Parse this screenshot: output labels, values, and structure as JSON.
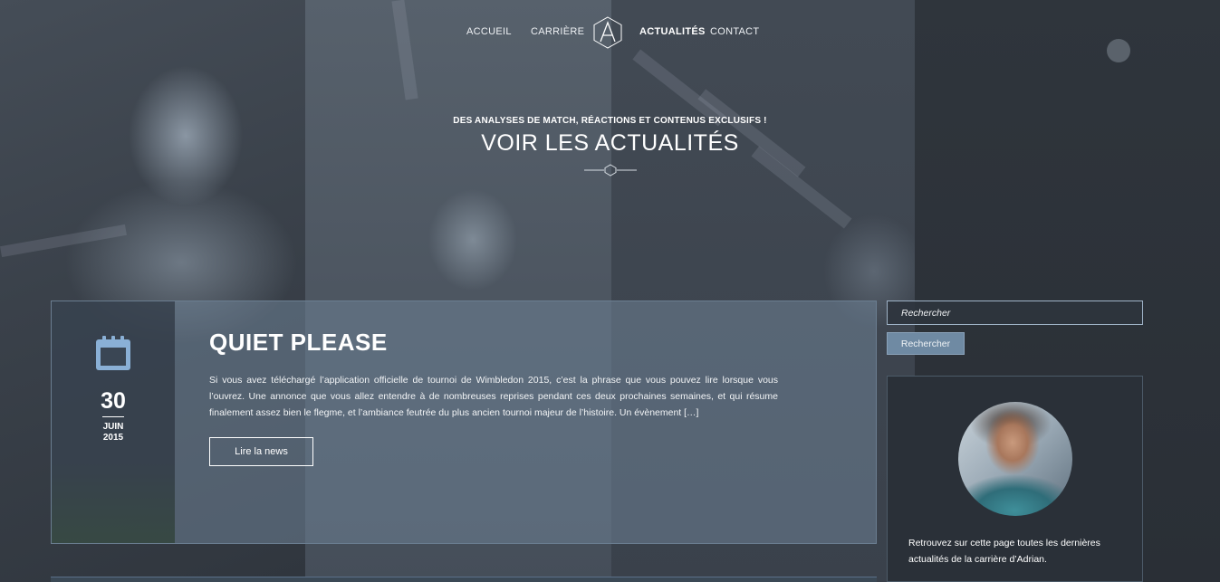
{
  "nav": {
    "items": [
      {
        "label": "ACCUEIL"
      },
      {
        "label": "CARRIÈRE"
      },
      {
        "label": "ACTUALITÉS",
        "active": true
      },
      {
        "label": "CONTACT"
      }
    ],
    "logo_icon": "a-monogram-hexagon-logo"
  },
  "hero": {
    "subtitle": "DES ANALYSES DE MATCH, RÉACTIONS ET CONTENUS EXCLUSIFS !",
    "title": "VOIR LES ACTUALITÉS"
  },
  "article": {
    "date_icon": "calendar-icon",
    "day": "30",
    "month": "JUIN",
    "year": "2015",
    "title": "QUIET PLEASE",
    "excerpt": "Si vous avez téléchargé l’application officielle de tournoi de Wimbledon 2015, c’est la phrase que vous pouvez lire lorsque vous l’ouvrez. Une annonce que vous allez entendre à de nombreuses reprises pendant ces deux prochaines semaines, et qui résume finalement assez bien le flegme, et l’ambiance feutrée du plus ancien tournoi majeur de l’histoire. Un évènement […]",
    "button_label": "Lire la news"
  },
  "sidebar": {
    "search_placeholder": "Rechercher",
    "search_button": "Rechercher",
    "profile_text": "Retrouvez sur cette page toutes les dernières actualités de la carrière d’Adrian."
  },
  "colors": {
    "accent_button": "#6f8aa3",
    "card_tint": "#6e8296",
    "calendar_icon": "#8ab0d6"
  }
}
